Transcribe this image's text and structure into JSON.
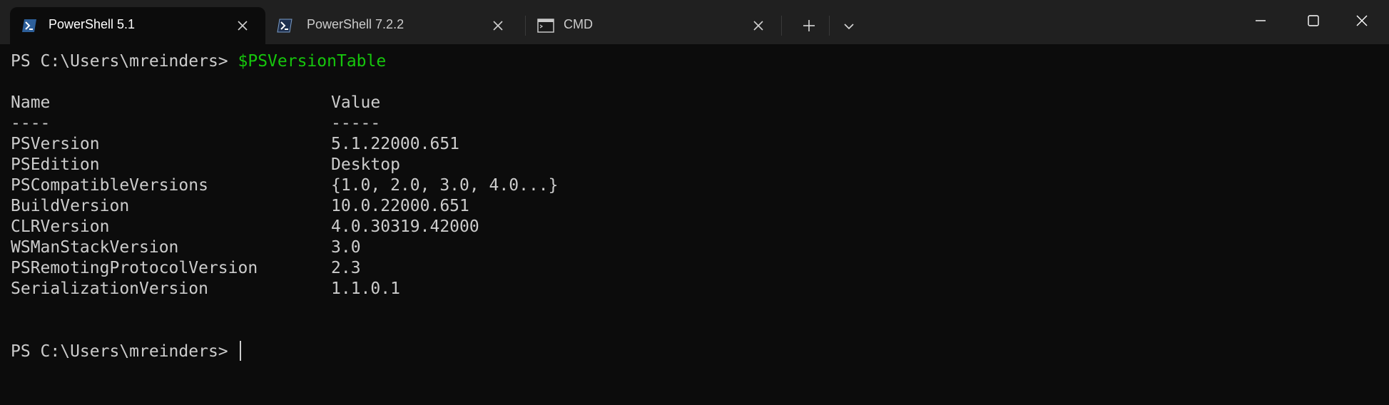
{
  "tabs": [
    {
      "title": "PowerShell 5.1",
      "icon": "powershell-icon",
      "active": true
    },
    {
      "title": "PowerShell 7.2.2",
      "icon": "powershell-icon",
      "active": false
    },
    {
      "title": "CMD",
      "icon": "cmd-icon",
      "active": false
    }
  ],
  "toolbar": {
    "new_tab_icon": "plus-icon",
    "dropdown_icon": "chevron-down-icon"
  },
  "window_controls": [
    "minimize-icon",
    "maximize-icon",
    "close-icon"
  ],
  "terminal": {
    "prompt": "PS C:\\Users\\mreinders> ",
    "command": "$PSVersionTable",
    "headers": {
      "name": "Name",
      "value": "Value"
    },
    "underline": {
      "name": "----",
      "value": "-----"
    },
    "rows": [
      {
        "name": "PSVersion",
        "value": "5.1.22000.651"
      },
      {
        "name": "PSEdition",
        "value": "Desktop"
      },
      {
        "name": "PSCompatibleVersions",
        "value": "{1.0, 2.0, 3.0, 4.0...}"
      },
      {
        "name": "BuildVersion",
        "value": "10.0.22000.651"
      },
      {
        "name": "CLRVersion",
        "value": "4.0.30319.42000"
      },
      {
        "name": "WSManStackVersion",
        "value": "3.0"
      },
      {
        "name": "PSRemotingProtocolVersion",
        "value": "2.3"
      },
      {
        "name": "SerializationVersion",
        "value": "1.1.0.1"
      }
    ],
    "final_prompt": "PS C:\\Users\\mreinders> "
  },
  "colors": {
    "command": "#16c60c",
    "text": "#cccccc",
    "background": "#0c0c0c",
    "tabbar": "#202020"
  }
}
